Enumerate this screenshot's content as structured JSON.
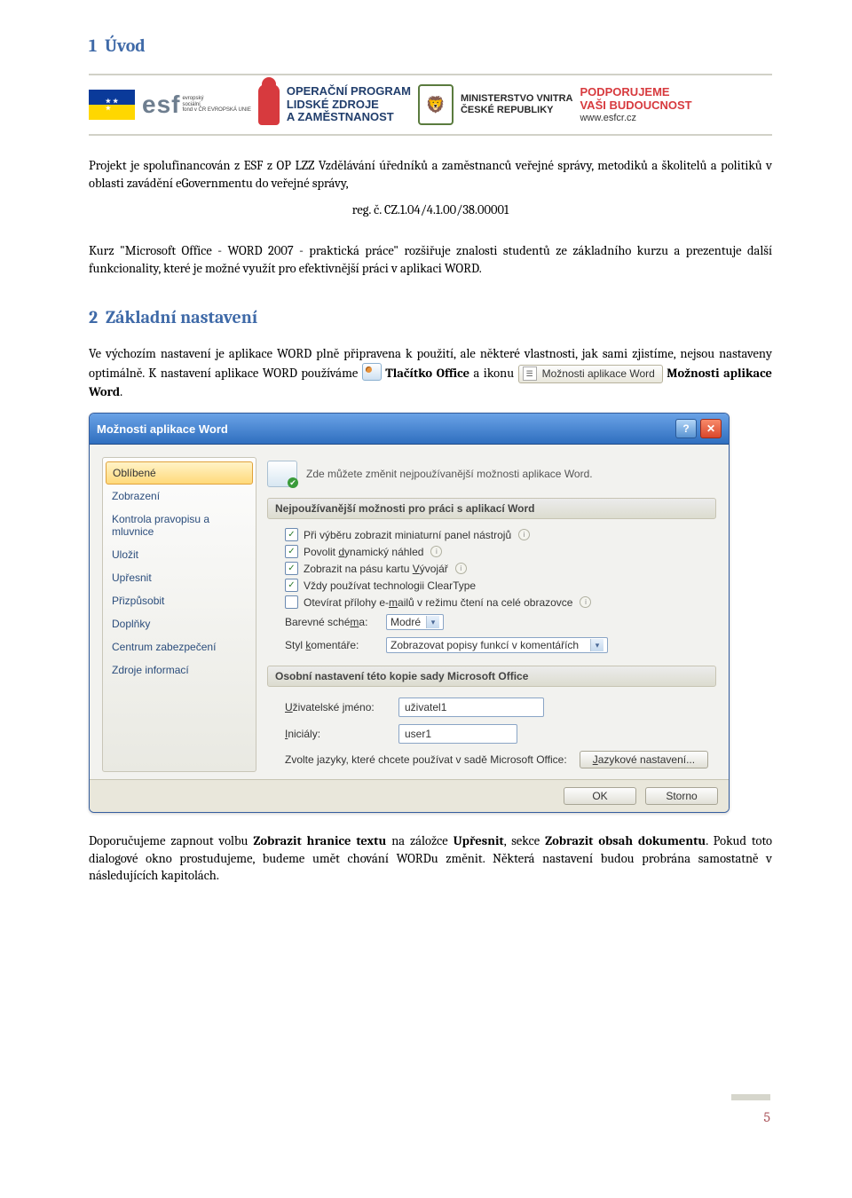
{
  "section1": {
    "num": "1",
    "title": "Úvod"
  },
  "logos": {
    "esf": "esf",
    "esf_sub": "evropský\nsociální\nfond v ČR  EVROPSKÁ UNIE",
    "oplz_l1": "OPERAČNÍ PROGRAM",
    "oplz_l2": "LIDSKÉ ZDROJE",
    "oplz_l3": "A ZAMĚSTNANOST",
    "mv_l1": "MINISTERSTVO VNITRA",
    "mv_l2": "ČESKÉ REPUBLIKY",
    "pod_l1": "PODPORUJEME",
    "pod_l2": "VAŠI BUDOUCNOST",
    "pod_url": "www.esfcr.cz"
  },
  "intro": {
    "p1": "Projekt je spolufinancován z ESF z OP LZZ Vzdělávání úředníků a zaměstnanců veřejné správy, metodiků a školitelů a politiků v oblasti zavádění eGovernmentu do veřejné správy,",
    "reg": "reg. č. CZ.1.04/4.1.00/38.00001",
    "p2": "Kurz \"Microsoft Office - WORD 2007 - praktická práce\" rozšiřuje znalosti studentů ze základního kurzu a prezentuje další funkcionality, které je možné využít pro efektivnější práci v aplikaci WORD."
  },
  "section2": {
    "num": "2",
    "title": "Základní nastavení"
  },
  "body2": {
    "p1a": "Ve výchozím nastavení je aplikace WORD plně připravena k použití, ale některé vlastnosti, jak sami zjistíme, nejsou nastaveny optimálně. K nastavení aplikace WORD používáme ",
    "office_btn": "Tlačítko Office",
    "p1b": "a ikonu ",
    "inline_btn_label": "Možnosti aplikace Word",
    "p1c": "Možnosti aplikace Word",
    "p1d": "."
  },
  "dialog": {
    "title": "Možnosti aplikace Word",
    "nav": [
      "Oblíbené",
      "Zobrazení",
      "Kontrola pravopisu a mluvnice",
      "Uložit",
      "Upřesnit",
      "Přizpůsobit",
      "Doplňky",
      "Centrum zabezpečení",
      "Zdroje informací"
    ],
    "nav_selected": 0,
    "header_text": "Zde můžete změnit nejpoužívanější možnosti aplikace Word.",
    "group1": "Nejpoužívanější možnosti pro práci s aplikací Word",
    "checks": [
      {
        "checked": true,
        "pre": "Při výběru zobrazit miniaturní panel nástrojů",
        "info": true
      },
      {
        "checked": true,
        "pre": "Povolit ",
        "u": "d",
        "post": "ynamický náhled",
        "info": true
      },
      {
        "checked": true,
        "pre": "Zobrazit na pásu kartu ",
        "u": "V",
        "post": "ývojář",
        "info": true
      },
      {
        "checked": true,
        "pre": "Vždy používat technologii ClearType",
        "info": false
      },
      {
        "checked": false,
        "pre": "Otevírat přílohy e-",
        "u": "m",
        "post": "ailů v režimu čtení na celé obrazovce",
        "info": true
      }
    ],
    "scheme_label_pre": "Barevné sché",
    "scheme_label_u": "m",
    "scheme_label_post": "a:",
    "scheme_value": "Modré",
    "comment_label_pre": "Styl ",
    "comment_label_u": "k",
    "comment_label_post": "omentáře:",
    "comment_value": "Zobrazovat popisy funkcí v komentářích",
    "group2": "Osobní nastavení této kopie sady Microsoft Office",
    "user_label_pre": "",
    "user_label_u": "U",
    "user_label_post": "živatelské jméno:",
    "user_value": "uživatel1",
    "init_label_pre": "",
    "init_label_u": "I",
    "init_label_post": "niciály:",
    "init_value": "user1",
    "lang_text": "Zvolte jazyky, které chcete používat v sadě Microsoft Office:",
    "lang_btn_pre": "",
    "lang_btn_u": "J",
    "lang_btn_post": "azykové nastavení...",
    "ok": "OK",
    "cancel": "Storno"
  },
  "closing": {
    "t1": "Doporučujeme zapnout volbu ",
    "b1": "Zobrazit hranice textu",
    "t2": " na záložce ",
    "b2": "Upřesnit",
    "t3": ", sekce ",
    "b3": "Zobrazit obsah dokumentu",
    "t4": ". Pokud toto dialogové okno prostudujeme, budeme umět chování WORDu změnit. Některá nastavení budou probrána samostatně v následujících kapitolách."
  },
  "page_num": "5"
}
